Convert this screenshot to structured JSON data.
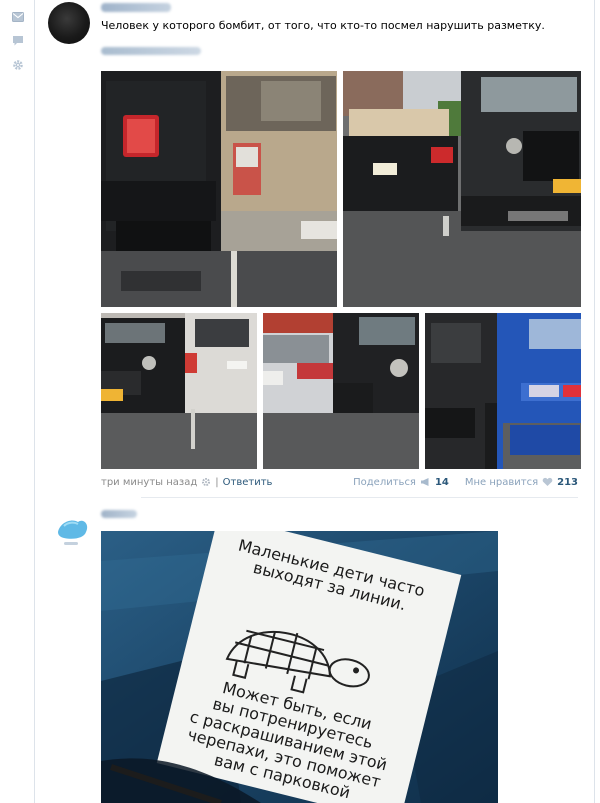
{
  "sidebar": {
    "icons": [
      "mail-icon",
      "chat-icon",
      "gear-icon"
    ]
  },
  "post1": {
    "text": "Человек у которого бомбит, от того, что кто-то посмел нарушить разметку.",
    "time": "три минуты назад",
    "reply_label": "Ответить",
    "share_label": "Поделиться",
    "share_count": "14",
    "like_label": "Мне нравится",
    "like_count": "213"
  },
  "post2": {
    "note_text": "Маленькие дети часто выходят за линии. Может быть, если вы потренируетесь с раскрашиванием этой черепахи, это поможет вам с парковкой"
  },
  "colors": {
    "link": "#2b587a",
    "muted": "#8a8a8a",
    "border": "#dde3ea",
    "icon": "#a7b7c9"
  }
}
